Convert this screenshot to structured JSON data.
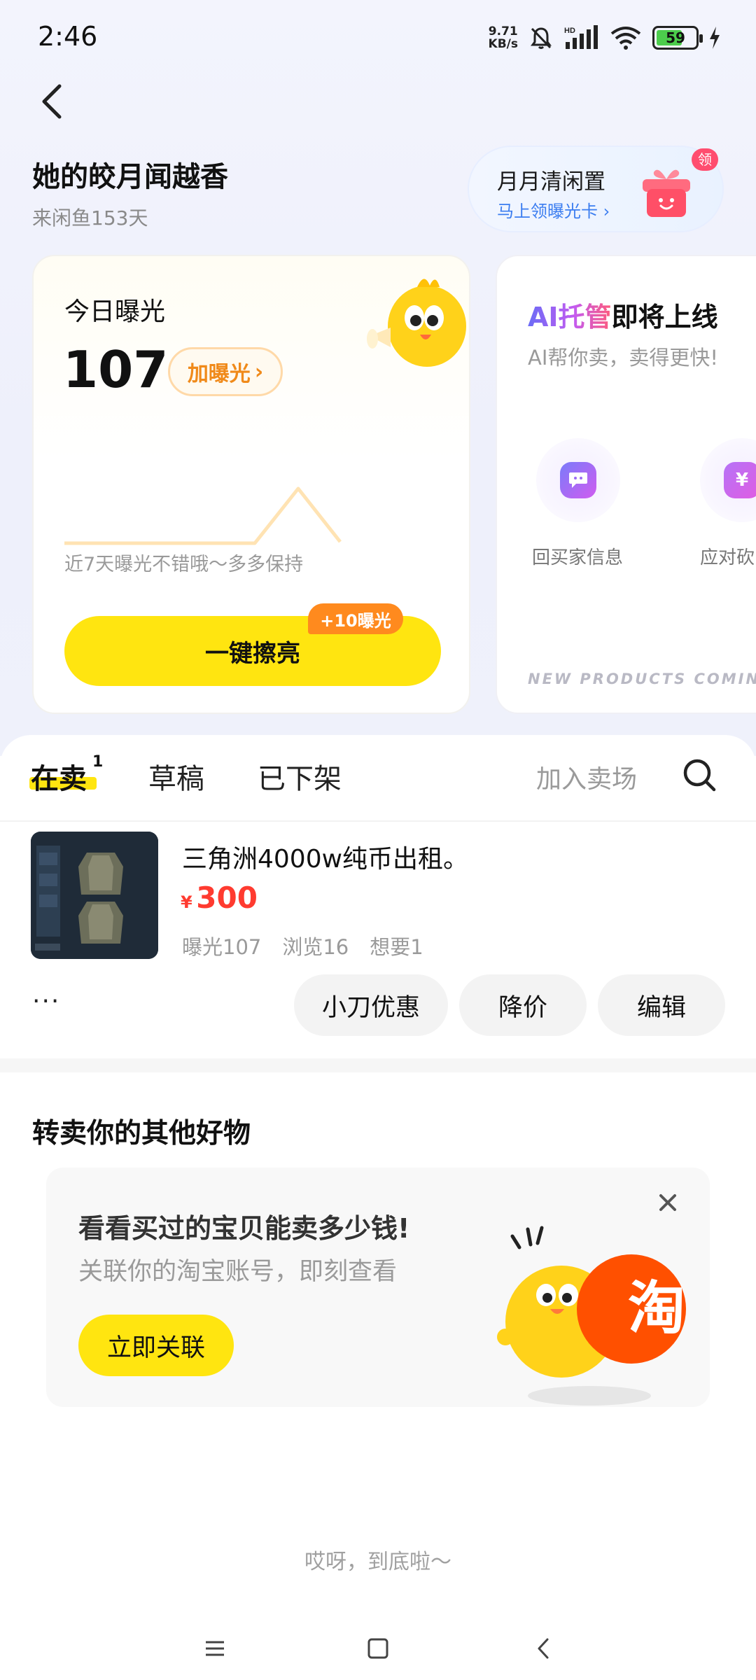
{
  "status_bar": {
    "time": "2:46",
    "net_speed_value": "9.71",
    "net_speed_unit": "KB/s",
    "battery": "59"
  },
  "header": {
    "user_name": "她的皎月闻越香",
    "user_days": "来闲鱼153天",
    "promo_title": "月月清闲置",
    "promo_sub": "马上领曝光卡",
    "promo_badge": "领"
  },
  "exposure_card": {
    "title": "今日曝光",
    "value": "107",
    "boost_label": "加曝光",
    "hint": "近7天曝光不错哦～多多保持",
    "shine_label": "一键擦亮",
    "shine_badge": "+10曝光"
  },
  "ai_card": {
    "title_prefix": "AI托管",
    "title_suffix": "即将上线",
    "subtitle": "AI帮你卖，卖得更快!",
    "feature1_label": "回买家信息",
    "feature2_label": "应对砍",
    "footer": "NEW PRODUCTS COMING S"
  },
  "tabs": {
    "on_sale": "在卖",
    "on_sale_count": "1",
    "drafts": "草稿",
    "off_shelf": "已下架",
    "join_market": "加入卖场"
  },
  "product": {
    "title": "三角洲4000w纯币出租。",
    "price_symbol": "¥",
    "price": "300",
    "exposure": "曝光107",
    "views": "浏览16",
    "wants": "想要1",
    "more": "···",
    "actions": {
      "discount": "小刀优惠",
      "reduce_price": "降价",
      "edit": "编辑"
    }
  },
  "resell": {
    "title": "转卖你的其他好物",
    "card_title": "看看买过的宝贝能卖多少钱!",
    "card_sub": "关联你的淘宝账号，即刻查看",
    "card_button": "立即关联",
    "taobao_glyph": "淘"
  },
  "footer": {
    "end_text": "哎呀，到底啦～"
  },
  "colors": {
    "accent_yellow": "#ffe510",
    "price_red": "#ff3b30",
    "orange": "#ff8a1e",
    "taobao_orange": "#ff5000"
  }
}
